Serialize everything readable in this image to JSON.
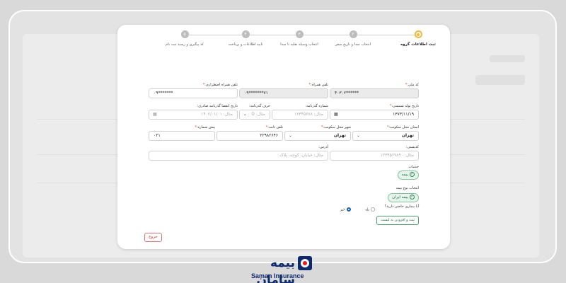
{
  "stepper": {
    "steps": [
      {
        "label": "ثبت اطلاعات گروه",
        "num": ""
      },
      {
        "label": "انتخاب مبدا و تاریخ سفر",
        "num": "۲"
      },
      {
        "label": "انتخاب وسیله نقلیه تا مبدا",
        "num": "۳"
      },
      {
        "label": "تایید اطلاعات و پرداخت",
        "num": "۴"
      },
      {
        "label": "کد پیگیری و رسید ثبت نام",
        "num": "۵"
      }
    ]
  },
  "form": {
    "national_code": {
      "label": "کد ملی:",
      "value": "۴۰۳۰۲******"
    },
    "mobile": {
      "label": "تلفن همراه:",
      "value": "۰۹*******۷۱"
    },
    "emergency_mobile": {
      "label": "تلفن همراه اضطراری:",
      "value": "۰۹*******"
    },
    "birth_date": {
      "label": "تاریخ تولد شمسی:",
      "value": "۱۳۷۳/۱۱/۱۹"
    },
    "passport_number": {
      "label": "شماره گذرنامه:",
      "placeholder": "مثال: ۱۲۳۴۵۶۷۸"
    },
    "passport_letter": {
      "label": "حرف گذرنامه:",
      "placeholder": "مثال: D"
    },
    "passport_expiry": {
      "label": "تاریخ انقضا گذرنامه صادری:",
      "placeholder": "مثال: ۱۴۰۲/۰۱/۰۱"
    },
    "province": {
      "label": "استان محل سکونت:",
      "value": "تهران"
    },
    "city": {
      "label": "شهر محل سکونت:",
      "value": "تهران"
    },
    "landline": {
      "label": "تلفن ثابت:",
      "value": "۲۲۹۸۲۶۴۶"
    },
    "area_code": {
      "label": "پیش شماره:",
      "value": "۰۲۱"
    },
    "postal_code": {
      "label": "کدپستی:",
      "placeholder": "مثال: ۱۲۳۴۵۶۷۸۹۰"
    },
    "address": {
      "label": "آدرس:",
      "placeholder": "مثال: خیابان، کوچه، پلاک"
    },
    "services": {
      "label": "خدمات",
      "chip": "بیمه"
    },
    "insurance_type": {
      "label": "انتخاب نوع بیمه",
      "chip": "بیمه ایران"
    },
    "disease": {
      "label": "آیا بیماری خاصی دارید؟",
      "yes": "بله",
      "no": "خیر"
    },
    "submit_label": "ثبت و افزودن به لیست",
    "exit_label": "خروج"
  },
  "logo": {
    "fa": "بیمه سامان",
    "en": "Saman Insurance"
  },
  "colors": {
    "accent": "#f6b73c",
    "green": "#4aa36c",
    "danger": "#d32f2f",
    "brand": "#0d2a6e"
  }
}
